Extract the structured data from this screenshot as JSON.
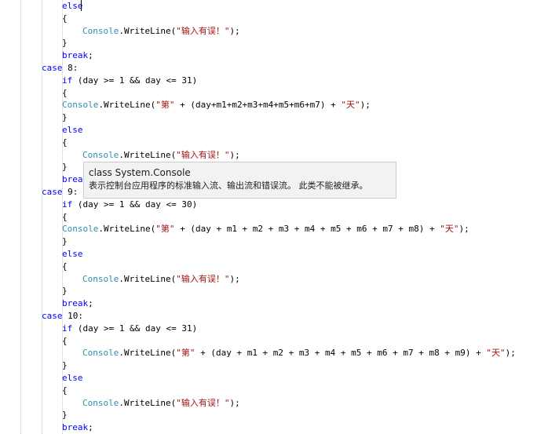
{
  "editor": {
    "lines": [
      {
        "indent": 2,
        "tokens": [
          {
            "t": "kw",
            "v": "else"
          }
        ]
      },
      {
        "indent": 2,
        "tokens": [
          {
            "t": "p",
            "v": "{"
          }
        ]
      },
      {
        "indent": 3,
        "tokens": [
          {
            "t": "cls",
            "v": "Console"
          },
          {
            "t": "p",
            "v": ".WriteLine("
          },
          {
            "t": "str",
            "v": "\"输入有误！\""
          },
          {
            "t": "p",
            "v": ");"
          }
        ]
      },
      {
        "indent": 2,
        "tokens": [
          {
            "t": "p",
            "v": "}"
          }
        ]
      },
      {
        "indent": 2,
        "tokens": [
          {
            "t": "kw",
            "v": "break"
          },
          {
            "t": "p",
            "v": ";"
          }
        ]
      },
      {
        "indent": 1,
        "tokens": [
          {
            "t": "kw",
            "v": "case"
          },
          {
            "t": "p",
            "v": " 8:"
          }
        ]
      },
      {
        "indent": 2,
        "tokens": [
          {
            "t": "kw",
            "v": "if"
          },
          {
            "t": "p",
            "v": " (day >= 1 && day <= 31)"
          }
        ]
      },
      {
        "indent": 2,
        "tokens": [
          {
            "t": "p",
            "v": "{"
          }
        ]
      },
      {
        "indent": 2,
        "tokens": [
          {
            "t": "cls",
            "v": "Console"
          },
          {
            "t": "p",
            "v": ".WriteLine("
          },
          {
            "t": "str",
            "v": "\"第\""
          },
          {
            "t": "p",
            "v": " + (day+m1+m2+m3+m4+m5+m6+m7) + "
          },
          {
            "t": "str",
            "v": "\"天\""
          },
          {
            "t": "p",
            "v": ");"
          }
        ]
      },
      {
        "indent": 2,
        "tokens": [
          {
            "t": "p",
            "v": "}"
          }
        ]
      },
      {
        "indent": 2,
        "tokens": [
          {
            "t": "kw",
            "v": "else"
          }
        ]
      },
      {
        "indent": 2,
        "tokens": [
          {
            "t": "p",
            "v": "{"
          }
        ]
      },
      {
        "indent": 3,
        "tokens": [
          {
            "t": "cls",
            "v": "Console"
          },
          {
            "t": "p",
            "v": ".WriteLine("
          },
          {
            "t": "str",
            "v": "\"输入有误！\""
          },
          {
            "t": "p",
            "v": ");"
          }
        ]
      },
      {
        "indent": 2,
        "tokens": [
          {
            "t": "p",
            "v": "}"
          }
        ]
      },
      {
        "indent": 2,
        "tokens": [
          {
            "t": "kw",
            "v": "brea"
          }
        ]
      },
      {
        "indent": 1,
        "tokens": [
          {
            "t": "kw",
            "v": "case"
          },
          {
            "t": "p",
            "v": " 9:"
          }
        ]
      },
      {
        "indent": 2,
        "tokens": [
          {
            "t": "kw",
            "v": "if"
          },
          {
            "t": "p",
            "v": " (day >= 1 && day <= 30)"
          }
        ]
      },
      {
        "indent": 2,
        "tokens": [
          {
            "t": "p",
            "v": "{"
          }
        ]
      },
      {
        "indent": 2,
        "tokens": [
          {
            "t": "cls",
            "v": "Console"
          },
          {
            "t": "p",
            "v": ".WriteLine("
          },
          {
            "t": "str",
            "v": "\"第\""
          },
          {
            "t": "p",
            "v": " + (day + m1 + m2 + m3 + m4 + m5 + m6 + m7 + m8) + "
          },
          {
            "t": "str",
            "v": "\"天\""
          },
          {
            "t": "p",
            "v": ");"
          }
        ]
      },
      {
        "indent": 2,
        "tokens": [
          {
            "t": "p",
            "v": "}"
          }
        ]
      },
      {
        "indent": 2,
        "tokens": [
          {
            "t": "kw",
            "v": "else"
          }
        ]
      },
      {
        "indent": 2,
        "tokens": [
          {
            "t": "p",
            "v": "{"
          }
        ]
      },
      {
        "indent": 3,
        "tokens": [
          {
            "t": "cls",
            "v": "Console"
          },
          {
            "t": "p",
            "v": ".WriteLine("
          },
          {
            "t": "str",
            "v": "\"输入有误！\""
          },
          {
            "t": "p",
            "v": ");"
          }
        ]
      },
      {
        "indent": 2,
        "tokens": [
          {
            "t": "p",
            "v": "}"
          }
        ]
      },
      {
        "indent": 2,
        "tokens": [
          {
            "t": "kw",
            "v": "break"
          },
          {
            "t": "p",
            "v": ";"
          }
        ]
      },
      {
        "indent": 1,
        "tokens": [
          {
            "t": "kw",
            "v": "case"
          },
          {
            "t": "p",
            "v": " 10:"
          }
        ]
      },
      {
        "indent": 2,
        "tokens": [
          {
            "t": "kw",
            "v": "if"
          },
          {
            "t": "p",
            "v": " (day >= 1 && day <= 31)"
          }
        ]
      },
      {
        "indent": 2,
        "tokens": [
          {
            "t": "p",
            "v": "{"
          }
        ]
      },
      {
        "indent": 3,
        "tokens": [
          {
            "t": "cls",
            "v": "Console"
          },
          {
            "t": "p",
            "v": ".WriteLine("
          },
          {
            "t": "str",
            "v": "\"第\""
          },
          {
            "t": "p",
            "v": " + (day + m1 + m2 + m3 + m4 + m5 + m6 + m7 + m8 + m9) + "
          },
          {
            "t": "str",
            "v": "\"天\""
          },
          {
            "t": "p",
            "v": ");"
          }
        ]
      },
      {
        "indent": 2,
        "tokens": [
          {
            "t": "p",
            "v": "}"
          }
        ]
      },
      {
        "indent": 2,
        "tokens": [
          {
            "t": "kw",
            "v": "else"
          }
        ]
      },
      {
        "indent": 2,
        "tokens": [
          {
            "t": "p",
            "v": "{"
          }
        ]
      },
      {
        "indent": 3,
        "tokens": [
          {
            "t": "cls",
            "v": "Console"
          },
          {
            "t": "p",
            "v": ".WriteLine("
          },
          {
            "t": "str",
            "v": "\"输入有误！\""
          },
          {
            "t": "p",
            "v": ");"
          }
        ]
      },
      {
        "indent": 2,
        "tokens": [
          {
            "t": "p",
            "v": "}"
          }
        ]
      },
      {
        "indent": 2,
        "tokens": [
          {
            "t": "kw",
            "v": "break"
          },
          {
            "t": "p",
            "v": ";"
          }
        ]
      }
    ]
  },
  "tooltip": {
    "signature": "class System.Console",
    "description": "表示控制台应用程序的标准输入流、输出流和错误流。 此类不能被继承。"
  },
  "colors": {
    "keyword": "#0000ff",
    "class_name": "#2b91af",
    "string": "#a31515",
    "plain": "#000000"
  }
}
